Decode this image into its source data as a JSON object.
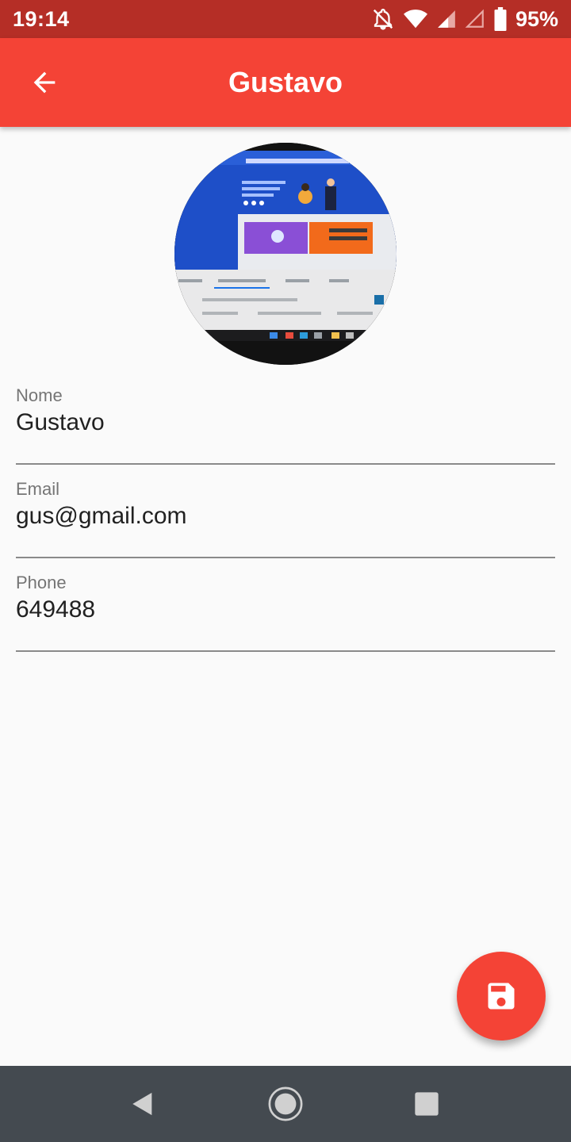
{
  "status_bar": {
    "time": "19:14",
    "battery_percent": "95%",
    "icons": [
      "notifications-off-icon",
      "wifi-icon",
      "signal-icon",
      "signal-empty-icon",
      "battery-icon"
    ]
  },
  "app_bar": {
    "title": "Gustavo",
    "back_icon": "arrow-back-icon",
    "color": "#f44336"
  },
  "contact": {
    "avatar": "contact-photo",
    "fields": [
      {
        "label": "Nome",
        "value": "Gustavo"
      },
      {
        "label": "Email",
        "value": "gus@gmail.com"
      },
      {
        "label": "Phone",
        "value": "649488"
      }
    ]
  },
  "fab": {
    "icon": "save-icon",
    "color": "#f44336"
  },
  "nav_bar": {
    "icons": [
      "nav-back-icon",
      "nav-home-icon",
      "nav-recents-icon"
    ]
  }
}
